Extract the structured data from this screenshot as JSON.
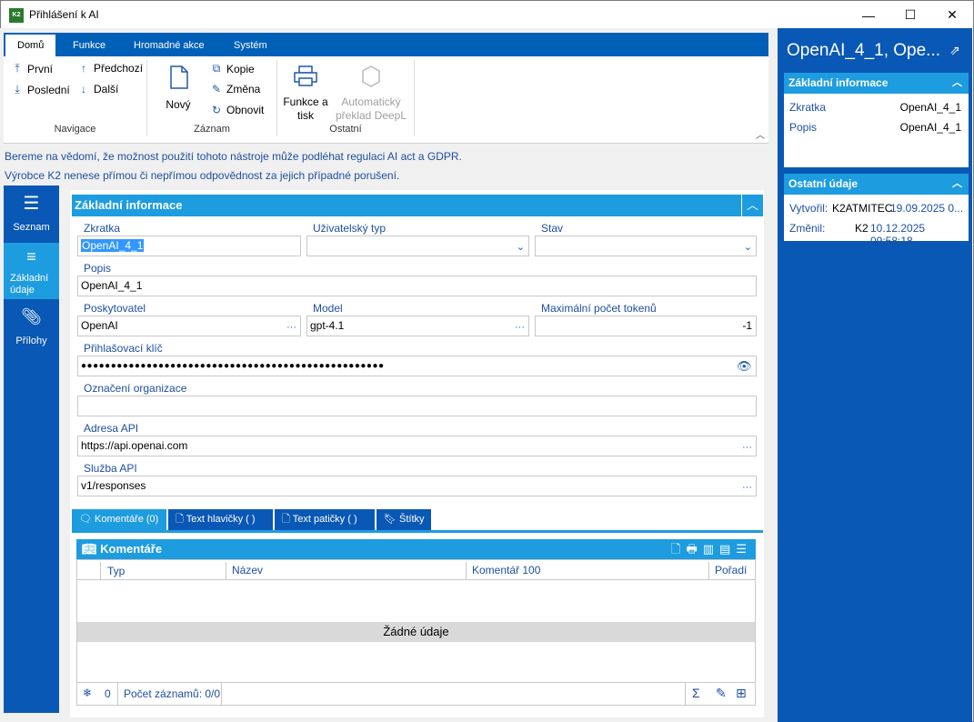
{
  "window": {
    "title": "Přihlášení k AI",
    "logo_text": "K2",
    "minimize": "—",
    "maximize": "☐",
    "close": "✕"
  },
  "ribbon": {
    "tabs": [
      "Domů",
      "Funkce",
      "Hromadné akce",
      "Systém"
    ],
    "nav": {
      "first": "První",
      "last": "Poslední",
      "prev": "Předchozí",
      "next": "Další",
      "group": "Navigace"
    },
    "record": {
      "new": "Nový",
      "copy": "Kopie",
      "change": "Změna",
      "refresh": "Obnovit",
      "group": "Záznam"
    },
    "other": {
      "print_line1": "Funkce a",
      "print_line2": "tisk",
      "translate_line1": "Automatický",
      "translate_line2": "překlad DeepL",
      "group": "Ostatní"
    }
  },
  "notices": [
    "Bereme na vědomí, že možnost použití tohoto nástroje může podléhat regulaci AI act a GDPR.",
    "Výrobce K2 nenese přímou či nepřímou odpovědnost za jejich případné porušení."
  ],
  "sidenav": [
    {
      "label": "Seznam"
    },
    {
      "label1": "Základní",
      "label2": "údaje"
    },
    {
      "label": "Přílohy"
    }
  ],
  "form": {
    "section_title": "Základní informace",
    "fields": {
      "zkratka": {
        "label": "Zkratka",
        "value": "OpenAI_4_1"
      },
      "typ": {
        "label": "Uživatelský typ",
        "value": ""
      },
      "stav": {
        "label": "Stav",
        "value": ""
      },
      "popis": {
        "label": "Popis",
        "value": "OpenAI_4_1"
      },
      "poskytovatel": {
        "label": "Poskytovatel",
        "value": "OpenAI"
      },
      "model": {
        "label": "Model",
        "value": "gpt-4.1"
      },
      "tokeny": {
        "label": "Maximální počet tokenů",
        "value": "-1"
      },
      "klic": {
        "label": "Přihlašovací klíč",
        "value": "●●●●●●●●●●●●●●●●●●●●●●●●●●●●●●●●●●●●●●●●●●●●●●●●●●●"
      },
      "organizace": {
        "label": "Označení organizace",
        "value": ""
      },
      "adresa": {
        "label": "Adresa API",
        "value": "https://api.openai.com"
      },
      "sluzba": {
        "label": "Služba API",
        "value": "v1/responses"
      }
    }
  },
  "subtabs": [
    "Komentáře (0)",
    "Text hlavičky ( )",
    "Text patičky ( )",
    "Štítky"
  ],
  "grid": {
    "title": "Komentáře",
    "columns": [
      "Typ",
      "Název",
      "Komentář 100",
      "Pořadí"
    ],
    "empty": "Žádné údaje",
    "footer_count": "0",
    "footer_records": "Počet záznamů: 0/0"
  },
  "right": {
    "title": "OpenAI_4_1, Ope...",
    "basic": {
      "header": "Základní informace",
      "rows": [
        {
          "k": "Zkratka",
          "v": "OpenAI_4_1"
        },
        {
          "k": "Popis",
          "v": "OpenAI_4_1"
        }
      ]
    },
    "other": {
      "header": "Ostatní údaje",
      "created_label": "Vytvořil:",
      "created_user": "K2ATMITEC",
      "created_date": "19.09.2025 0...",
      "changed_label": "Změnil:",
      "changed_user": "K2",
      "changed_date": "10.12.2025 09:58:18"
    }
  },
  "colors": {
    "primary": "#0a58b5",
    "accent": "#1d9ce0",
    "link": "#1e4fa0"
  }
}
